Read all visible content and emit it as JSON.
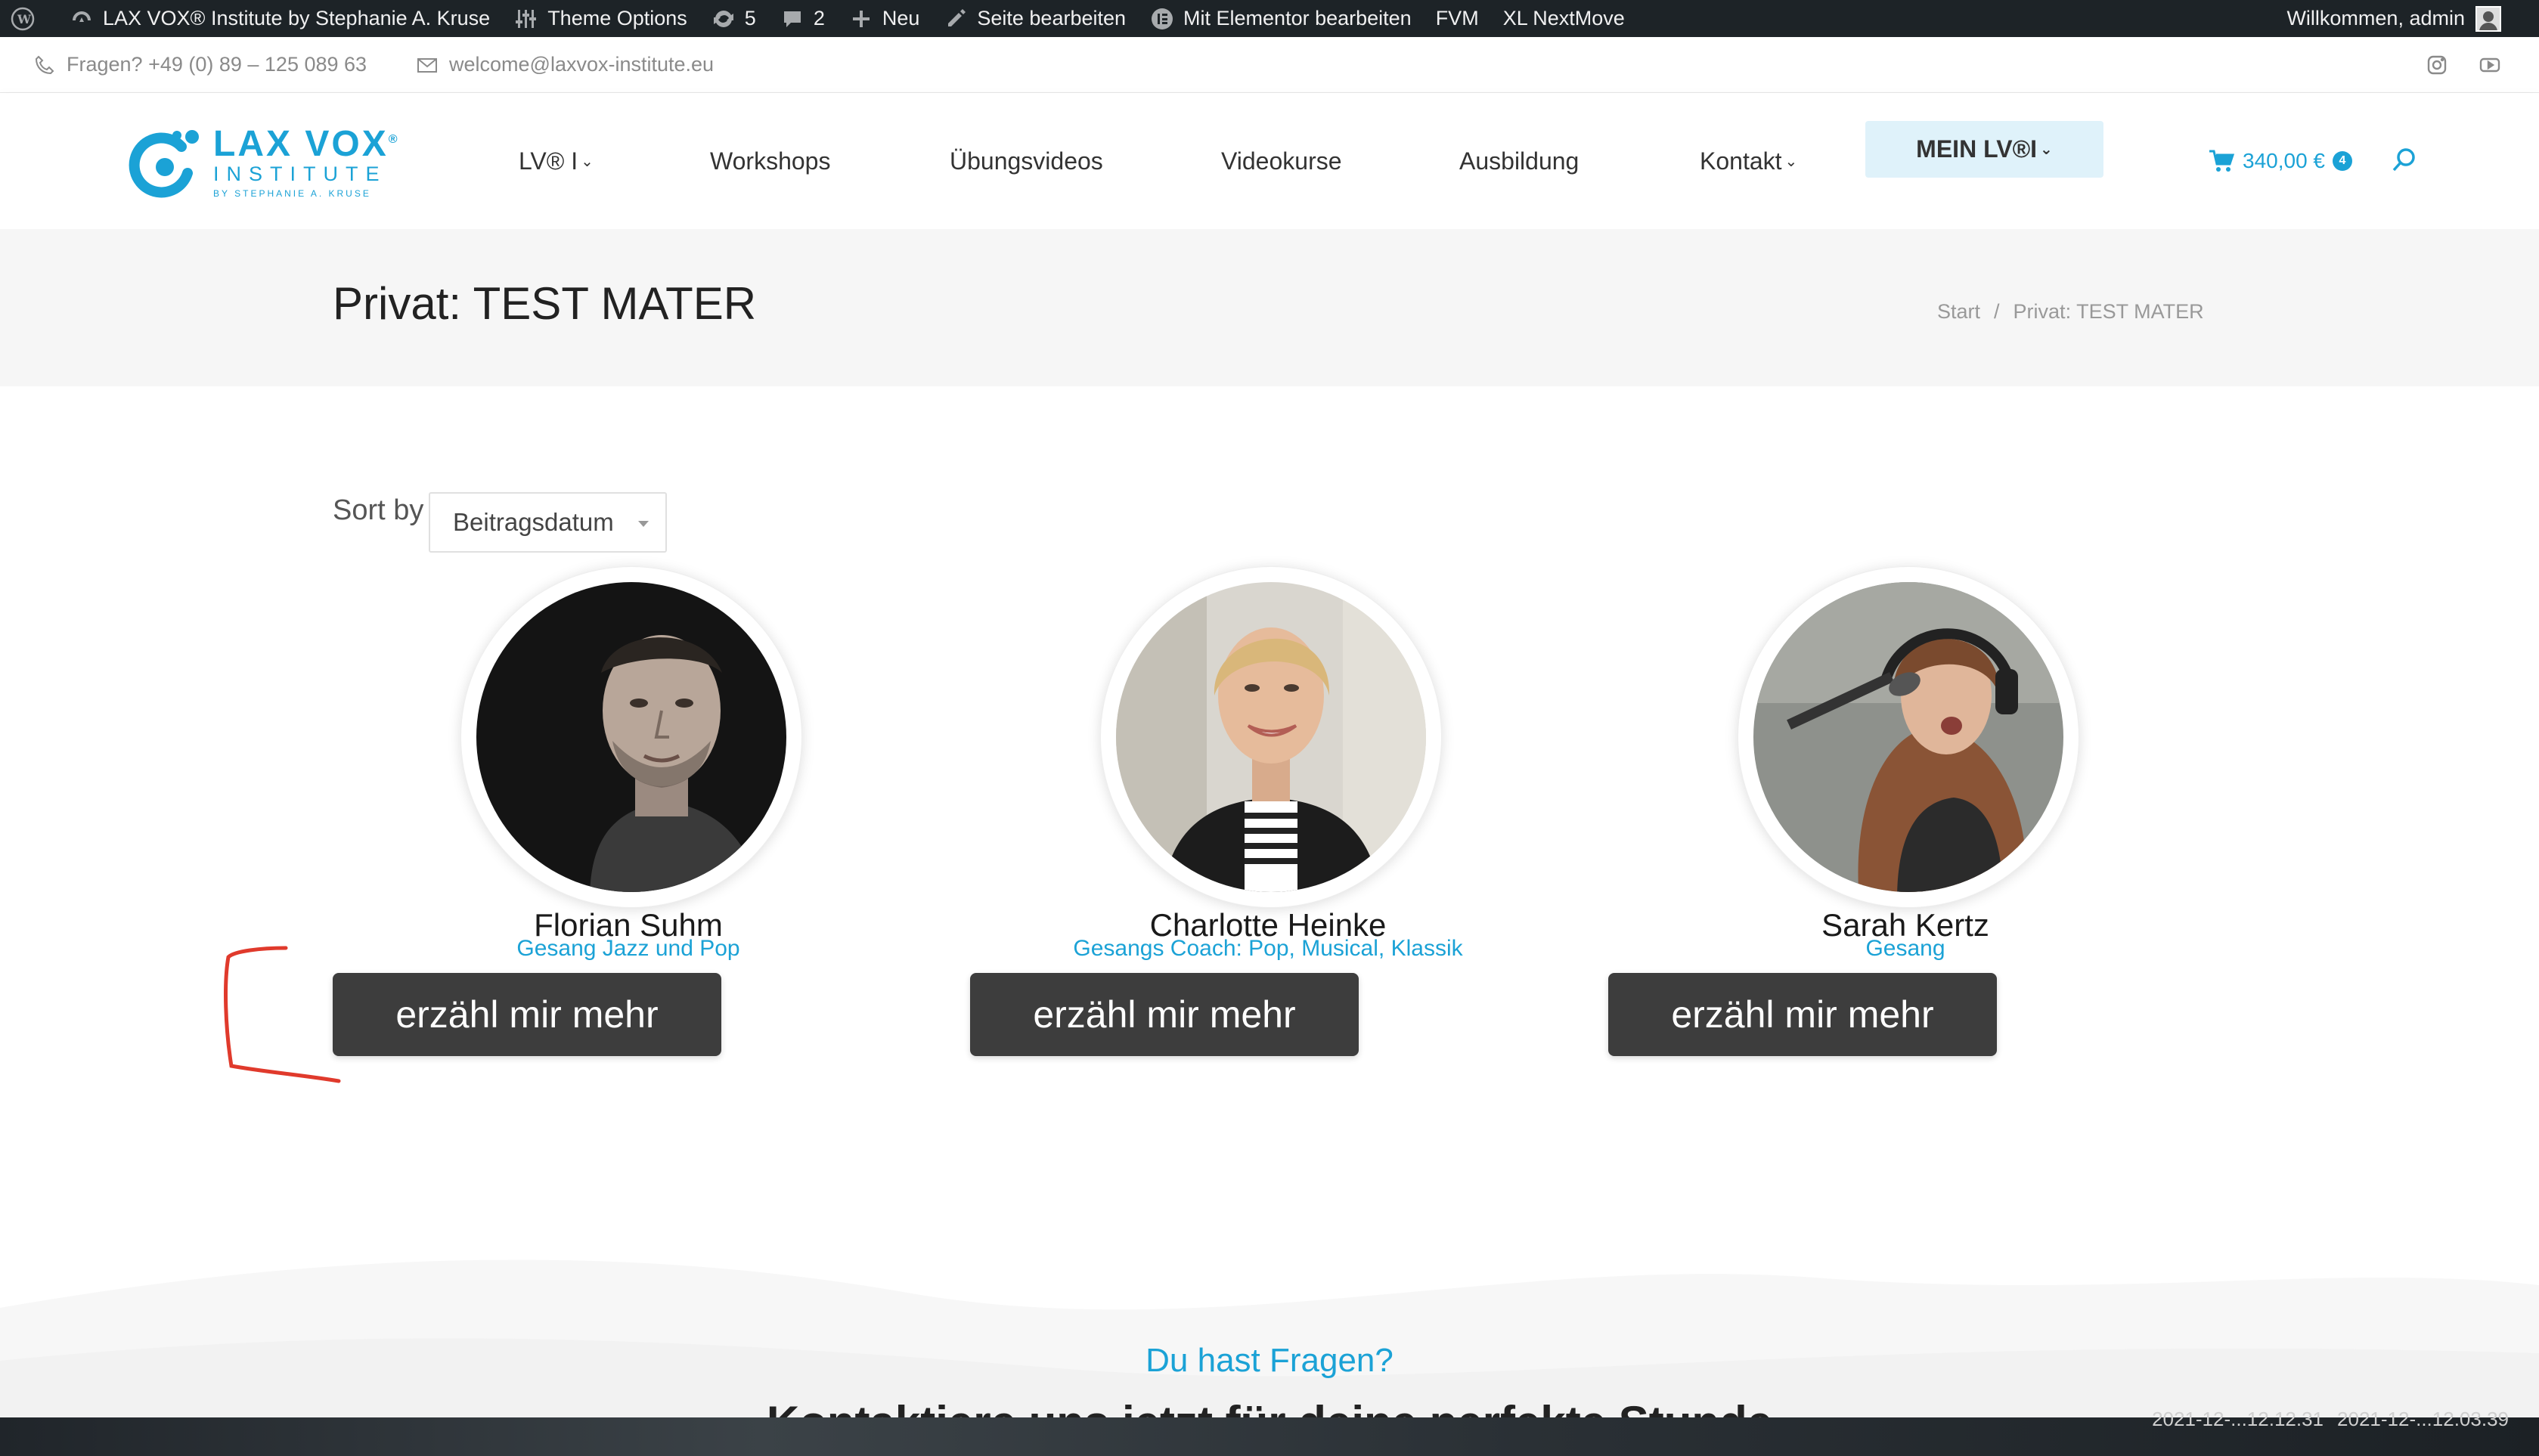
{
  "adminbar": {
    "site_name": "LAX VOX® Institute by Stephanie A. Kruse",
    "theme_options": "Theme Options",
    "updates_count": "5",
    "comments_count": "2",
    "new_label": "Neu",
    "edit_page": "Seite bearbeiten",
    "elementor": "Mit Elementor bearbeiten",
    "fvm": "FVM",
    "nextmove": "XL NextMove",
    "welcome": "Willkommen, admin"
  },
  "topinfo": {
    "phone": "Fragen? +49 (0) 89 – 125 089 63",
    "email": "welcome@laxvox-institute.eu"
  },
  "logo": {
    "main": "LAX VOX",
    "reg": "®",
    "sub": "INSTITUTE",
    "tag": "BY STEPHANIE A. KRUSE"
  },
  "nav": {
    "items": [
      {
        "label": "LV® I"
      },
      {
        "label": "Workshops"
      },
      {
        "label": "Übungsvideos"
      },
      {
        "label": "Videokurse"
      },
      {
        "label": "Ausbildung"
      },
      {
        "label": "Kontakt"
      }
    ],
    "mein": "MEIN LV®I",
    "cart_total": "340,00 €",
    "cart_count": "4"
  },
  "page": {
    "title": "Privat: TEST MATER",
    "breadcrumb_home": "Start",
    "breadcrumb_sep": "/",
    "breadcrumb_current": "Privat: TEST MATER"
  },
  "sort": {
    "label": "Sort by",
    "value": "Beitragsdatum"
  },
  "team": [
    {
      "name": "Florian Suhm",
      "role": "Gesang Jazz und Pop",
      "button": "erzähl mir mehr"
    },
    {
      "name": "Charlotte Heinke",
      "role": "Gesangs Coach: Pop, Musical, Klassik",
      "button": "erzähl mir mehr"
    },
    {
      "name": "Sarah Kertz",
      "role": "Gesang",
      "button": "erzähl mir mehr"
    }
  ],
  "footer": {
    "question": "Du hast Fragen?",
    "cut_heading": "Kontaktiere uns jetzt für deine perfekte Stunde"
  },
  "thumbs": {
    "a": "2021-12-...12.12.31",
    "b": "2021-12-...12.03.39"
  },
  "colors": {
    "accent": "#1ba2d6",
    "button": "#3d3d3d",
    "adminbar": "#1d2327",
    "annotation": "#e03a2c"
  }
}
